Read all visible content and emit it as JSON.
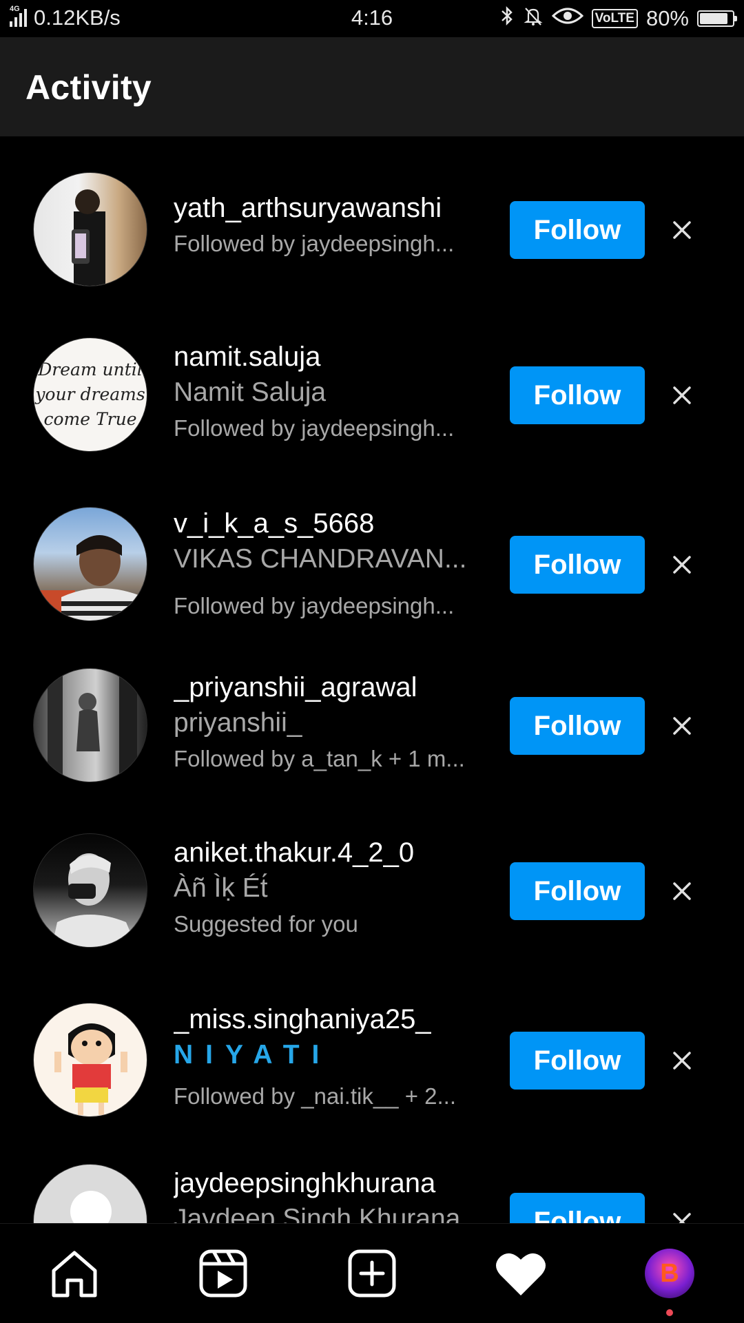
{
  "status_bar": {
    "network_type": "4G",
    "speed": "0.12KB/s",
    "time": "4:16",
    "volte": "VoLTE",
    "battery": "80%",
    "icons": [
      "bluetooth-icon",
      "bell-muted-icon",
      "eye-icon"
    ]
  },
  "header": {
    "title": "Activity"
  },
  "suggestions": [
    {
      "username": "yath_arthsuryawanshi",
      "full_name": "",
      "subtitle": "Followed by jaydeepsingh...",
      "button": "Follow"
    },
    {
      "username": "namit.saluja",
      "full_name": "Namit Saluja",
      "subtitle": "Followed by jaydeepsingh...",
      "button": "Follow",
      "avatar_text": [
        "Dream until",
        "your dreams",
        "come True"
      ]
    },
    {
      "username": "v_i_k_a_s_5668",
      "full_name": "VIKAS CHANDRAVAN...",
      "subtitle": "Followed by jaydeepsingh...",
      "button": "Follow"
    },
    {
      "username": "_priyanshii_agrawal",
      "full_name": "priyanshii_",
      "subtitle": "Followed by a_tan_k + 1 m...",
      "button": "Follow"
    },
    {
      "username": "aniket.thakur.4_2_0",
      "full_name": "Àñ Ìḳ Ét́",
      "subtitle": "Suggested for you",
      "button": "Follow"
    },
    {
      "username": "_miss.singhaniya25_",
      "full_name": "NIYATI",
      "subtitle": "Followed by _nai.tik__ + 2...",
      "button": "Follow"
    },
    {
      "username": "jaydeepsinghkhurana",
      "full_name": "Jaydeep Singh Khurana",
      "subtitle": "",
      "button": "Follow"
    }
  ],
  "bottom_nav": {
    "items": [
      "home-icon",
      "reels-icon",
      "new-post-icon",
      "activity-heart-icon",
      "profile-avatar"
    ],
    "profile_initial": "B"
  },
  "colors": {
    "follow_button": "#0095f6",
    "background": "#000000",
    "header": "#1b1b1b",
    "secondary_text": "#a8a8a8",
    "niyati_text": "#26a6e8"
  }
}
